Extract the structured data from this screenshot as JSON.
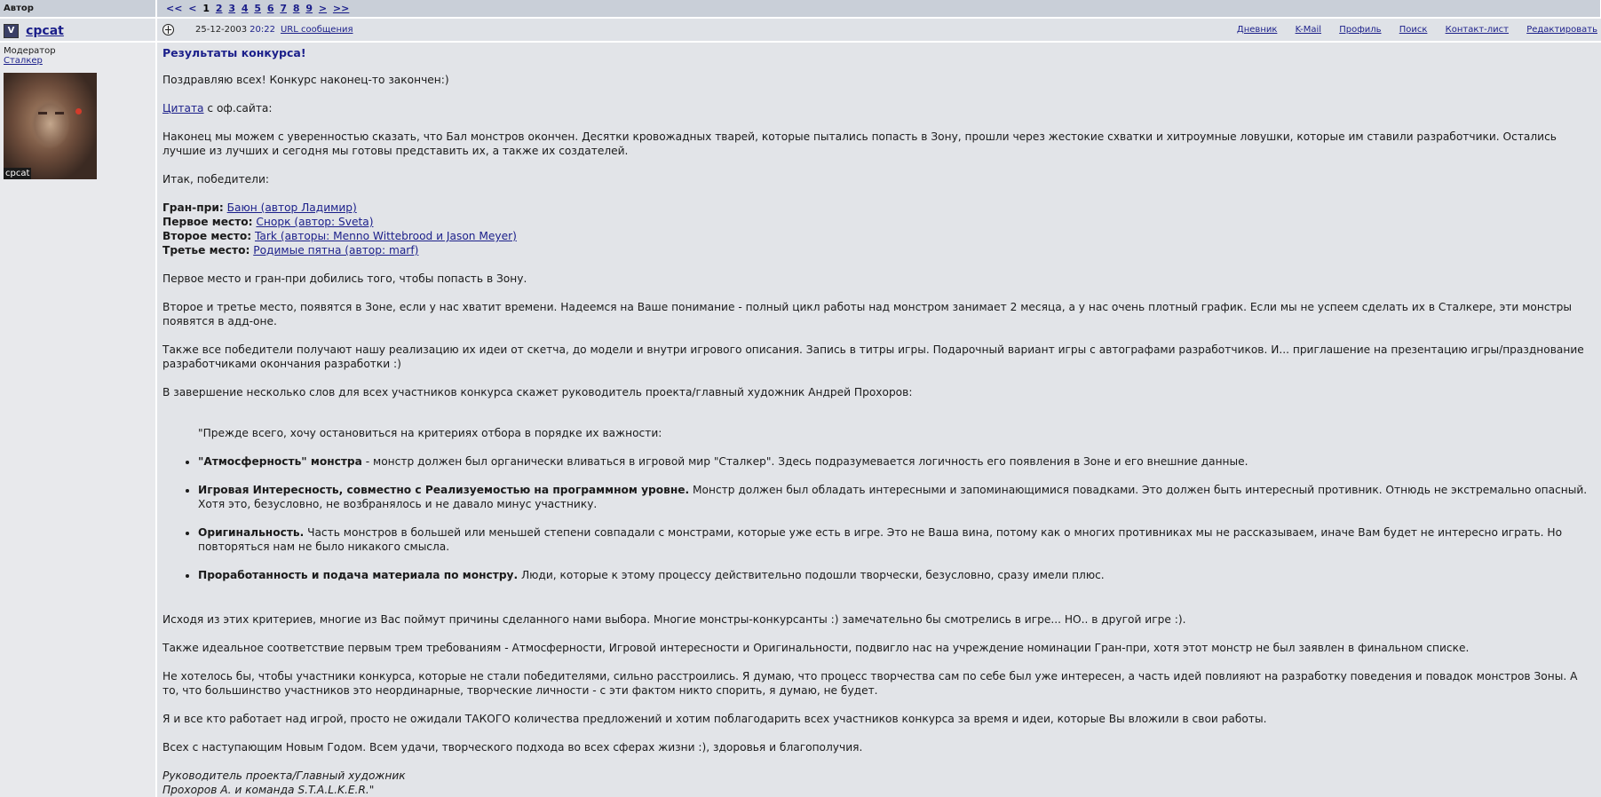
{
  "header": {
    "author_label": "Автор",
    "pager": {
      "first": "<<",
      "prev": "<",
      "current": "1",
      "pages": [
        "2",
        "3",
        "4",
        "5",
        "6",
        "7",
        "8",
        "9"
      ],
      "next": ">",
      "last": ">>"
    }
  },
  "post": {
    "author": {
      "badge": "V",
      "name": "cpcat",
      "role": "Модератор",
      "group_link": "Сталкер",
      "avatar_caption": "cpcat"
    },
    "date": "25-12-2003",
    "time": "20:22",
    "url_link": "URL сообщения",
    "links": [
      "Дневник",
      "K-Mail",
      "Профиль",
      "Поиск",
      "Контакт-лист",
      "Редактировать"
    ],
    "title": "Результаты конкурса!",
    "greeting": "Поздравляю всех! Конкурс наконец-то закончен:)",
    "quote_link": "Цитата",
    "quote_suffix": " с оф.сайта:",
    "intro": "Наконец мы можем с уверенностью сказать, что Бал монстров окончен. Десятки кровожадных тварей, которые пытались попасть в Зону, прошли через жестокие схватки и хитроумные ловушки, которые им ставили разработчики. Остались лучшие из лучших и сегодня мы готовы представить их, а также их создателей.",
    "winners_intro": "Итак, победители:",
    "winners": [
      {
        "label": "Гран-при:",
        "link": "Баюн (автор Ладимир)"
      },
      {
        "label": "Первое место:",
        "link": "Снорк (автор: Sveta)"
      },
      {
        "label": "Второе место:",
        "link": "Tark (авторы: Menno Wittebrood и Jason Meyer)"
      },
      {
        "label": "Третье место:",
        "link": "Родимые пятна (автор: marf)"
      }
    ],
    "p_first": "Первое место и гран-при добились того, чтобы попасть в Зону.",
    "p_second": "Второе и третье место, появятся в Зоне, если у нас хватит времени. Надеемся на Ваше понимание - полный цикл работы над монстром занимает 2 месяца, а у нас очень плотный график. Если мы не успеем сделать их в Сталкере, эти монстры появятся в адд-оне.",
    "p_also": "Также все победители получают нашу реализацию их идеи от скетча, до модели и внутри игрового описания. Запись в титры игры. Подарочный вариант игры с автографами разработчиков. И... приглашение на презентацию игры/празднование разработчиками окончания разработки :)",
    "p_final": "В завершение несколько слов для всех участников конкурса скажет руководитель проекта/главный художник Андрей Прохоров:",
    "quote_intro": "\"Прежде всего, хочу остановиться на критериях отбора в порядке их важности:",
    "criteria": [
      {
        "bold": "\"Атмосферность\" монстра",
        "text": " - монстр должен был органически вливаться в игровой мир \"Сталкер\". Здесь подразумевается логичность его появления в Зоне и его внешние данные."
      },
      {
        "bold": "Игровая Интересность, совместно с Реализуемостью на программном уровне.",
        "text": " Монстр должен был обладать интересными и запоминающимися повадками. Это должен быть интересный противник. Отнюдь не экстремально опасный. Хотя это, безусловно, не возбранялось и не давало минус участнику."
      },
      {
        "bold": "Оригинальность.",
        "text": " Часть монстров в большей или меньшей степени совпадали с монстрами, которые уже есть в игре. Это не Ваша вина, потому как о многих противниках мы не рассказываем, иначе Вам будет не интересно играть. Но повторяться нам не было никакого смысла."
      },
      {
        "bold": "Проработанность и подача материала по монстру.",
        "text": " Люди, которые к этому процессу действительно подошли творчески, безусловно, сразу имели плюс."
      }
    ],
    "p_based": "Исходя из этих критериев, многие из Вас поймут причины сделанного нами выбора. Многие монстры-конкурсанты :) замечательно бы смотрелись в игре... НО.. в другой игре :).",
    "p_ideal": "Также идеальное соответствие первым трем требованиям - Атмосферности, Игровой интересности и Оригинальности, подвигло нас на учреждение номинации Гран-при, хотя этот монстр не был заявлен в финальном списке.",
    "p_upset": "Не хотелось бы, чтобы участники конкурса, которые не стали победителями, сильно расстроились. Я думаю, что процесс творчества сам по себе был уже интересен, а часть идей повлияют на разработку поведения и повадок монстров Зоны. А то, что большинство участников это неординарные, творческие личности - с эти фактом никто спорить, я думаю, не будет.",
    "p_thanks": "Я и все кто работает над игрой, просто не ожидали ТАКОГО количества предложений и хотим поблагодарить всех участников конкурса за время и идеи, которые Вы вложили в свои работы.",
    "p_newyear": "Всех с наступающим Новым Годом. Всем удачи, творческого подхода во всех сферах жизни :), здоровья и благополучия.",
    "signature_1": "Руководитель проекта/Главный художник",
    "signature_2": "Прохоров А. и команда S.T.A.L.K.E.R.\""
  }
}
